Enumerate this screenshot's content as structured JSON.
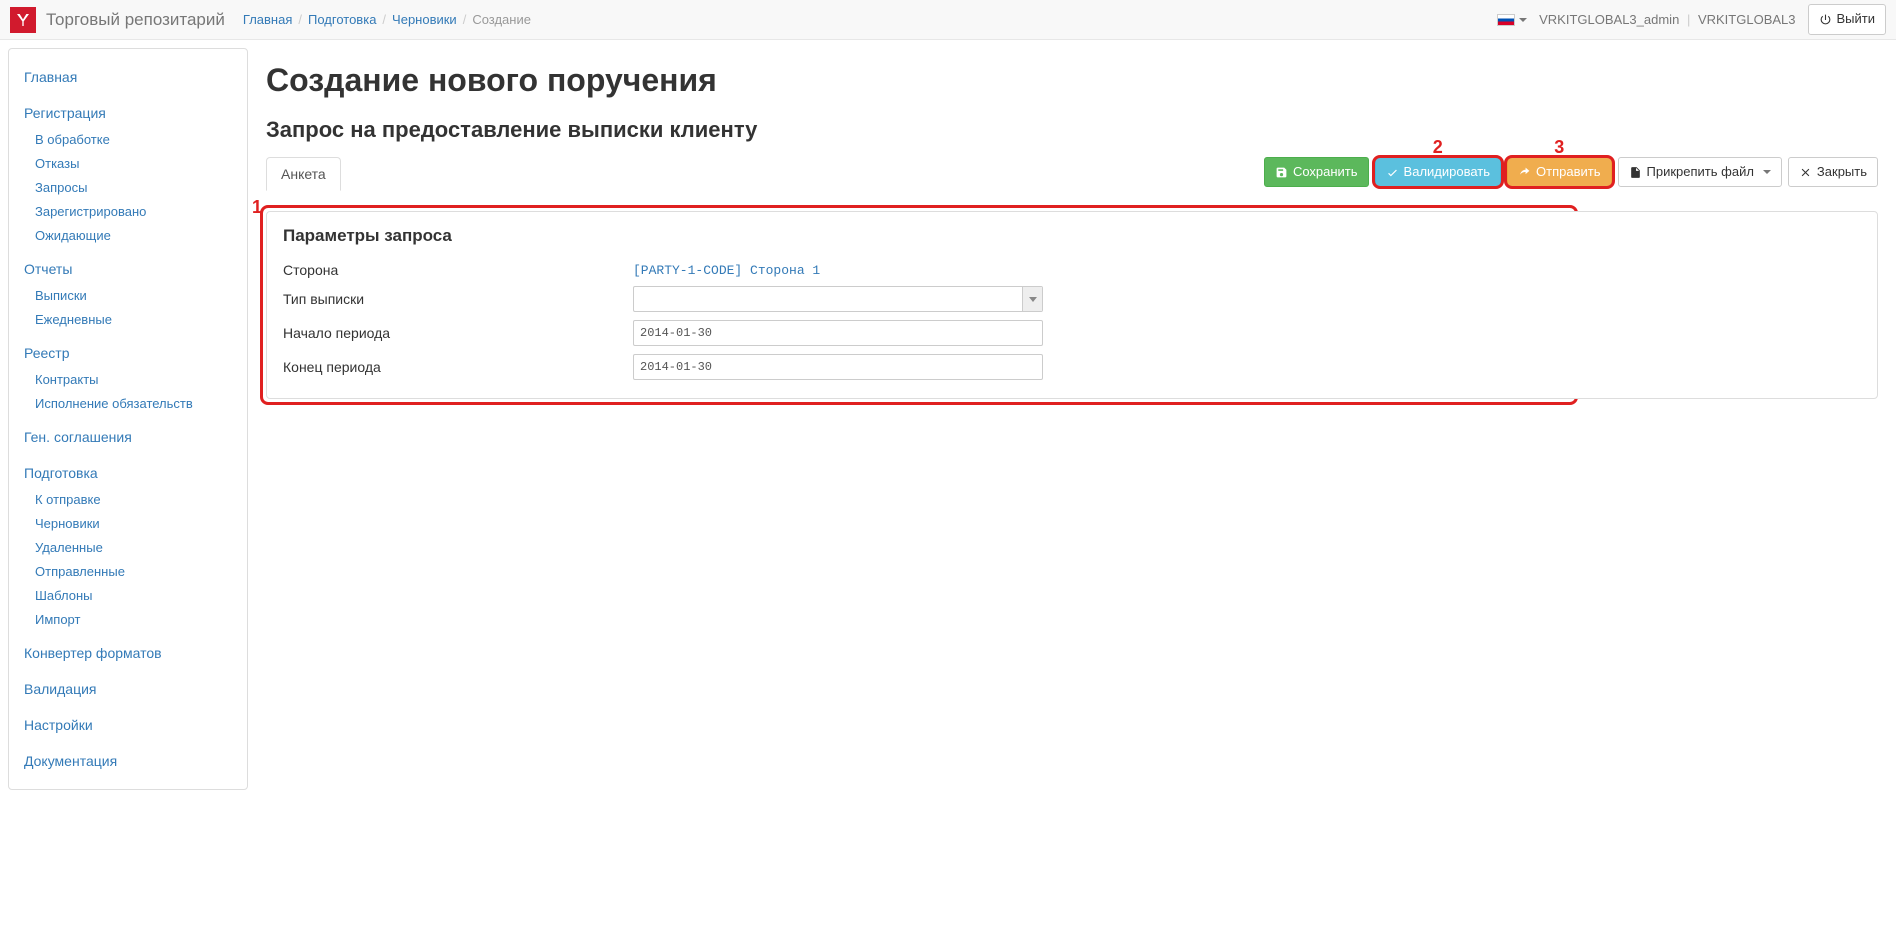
{
  "navbar": {
    "brand": "Торговый репозитарий",
    "breadcrumb": [
      "Главная",
      "Подготовка",
      "Черновики",
      "Создание"
    ],
    "user_admin": "VRKITGLOBAL3_admin",
    "user_org": "VRKITGLOBAL3",
    "logout_label": "Выйти"
  },
  "sidebar": [
    {
      "head": "Главная",
      "items": []
    },
    {
      "head": "Регистрация",
      "items": [
        "В обработке",
        "Отказы",
        "Запросы",
        "Зарегистрировано",
        "Ожидающие"
      ]
    },
    {
      "head": "Отчеты",
      "items": [
        "Выписки",
        "Ежедневные"
      ]
    },
    {
      "head": "Реестр",
      "items": [
        "Контракты",
        "Исполнение обязательств"
      ]
    },
    {
      "head": "Ген. соглашения",
      "items": []
    },
    {
      "head": "Подготовка",
      "items": [
        "К отправке",
        "Черновики",
        "Удаленные",
        "Отправленные",
        "Шаблоны",
        "Импорт"
      ]
    },
    {
      "head": "Конвертер форматов",
      "items": []
    },
    {
      "head": "Валидация",
      "items": []
    },
    {
      "head": "Настройки",
      "items": []
    },
    {
      "head": "Документация",
      "items": []
    }
  ],
  "page": {
    "title": "Создание нового поручения",
    "subtitle": "Запрос на предоставление выписки клиенту",
    "tab_label": "Анкета"
  },
  "buttons": {
    "save": "Сохранить",
    "validate": "Валидировать",
    "send": "Отправить",
    "attach": "Прикрепить файл",
    "close": "Закрыть"
  },
  "annotations": {
    "n1": "1",
    "n2": "2",
    "n3": "3"
  },
  "panel": {
    "title": "Параметры запроса",
    "rows": {
      "side_label": "Сторона",
      "side_value": "[PARTY-1-CODE] Сторона 1",
      "type_label": "Тип выписки",
      "type_value": "",
      "start_label": "Начало периода",
      "start_value": "2014-01-30",
      "end_label": "Конец периода",
      "end_value": "2014-01-30"
    }
  }
}
